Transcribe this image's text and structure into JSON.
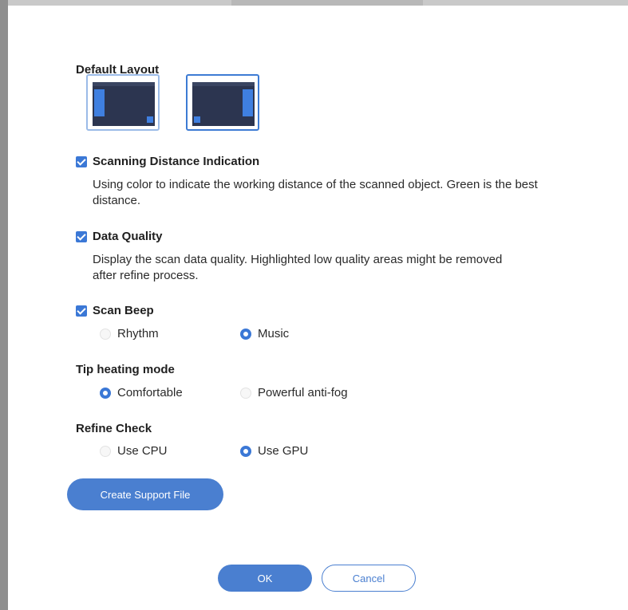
{
  "settings": {
    "default_layout": {
      "title": "Default Layout",
      "options": [
        {
          "name": "sidebar-left",
          "selected": false
        },
        {
          "name": "sidebar-right",
          "selected": true
        }
      ]
    },
    "scanning_distance": {
      "label": "Scanning Distance Indication",
      "checked": true,
      "description": "Using color to indicate the working distance of the scanned object. Green is the best distance."
    },
    "data_quality": {
      "label": "Data Quality",
      "checked": true,
      "description": "Display the scan data quality. Highlighted low quality areas might be removed after refine process."
    },
    "scan_beep": {
      "label": "Scan Beep",
      "checked": true,
      "options": [
        {
          "label": "Rhythm",
          "selected": false
        },
        {
          "label": "Music",
          "selected": true
        }
      ]
    },
    "tip_heating": {
      "title": "Tip heating mode",
      "options": [
        {
          "label": "Comfortable",
          "selected": true
        },
        {
          "label": "Powerful anti-fog",
          "selected": false
        }
      ]
    },
    "refine_check": {
      "title": "Refine Check",
      "options": [
        {
          "label": "Use CPU",
          "selected": false
        },
        {
          "label": "Use GPU",
          "selected": true
        }
      ]
    }
  },
  "buttons": {
    "support_file": "Create Support File",
    "ok": "OK",
    "cancel": "Cancel"
  },
  "colors": {
    "accent": "#3b78d6",
    "button_fill": "#4a7fd0",
    "thumbnail_bg": "#2c3550"
  }
}
